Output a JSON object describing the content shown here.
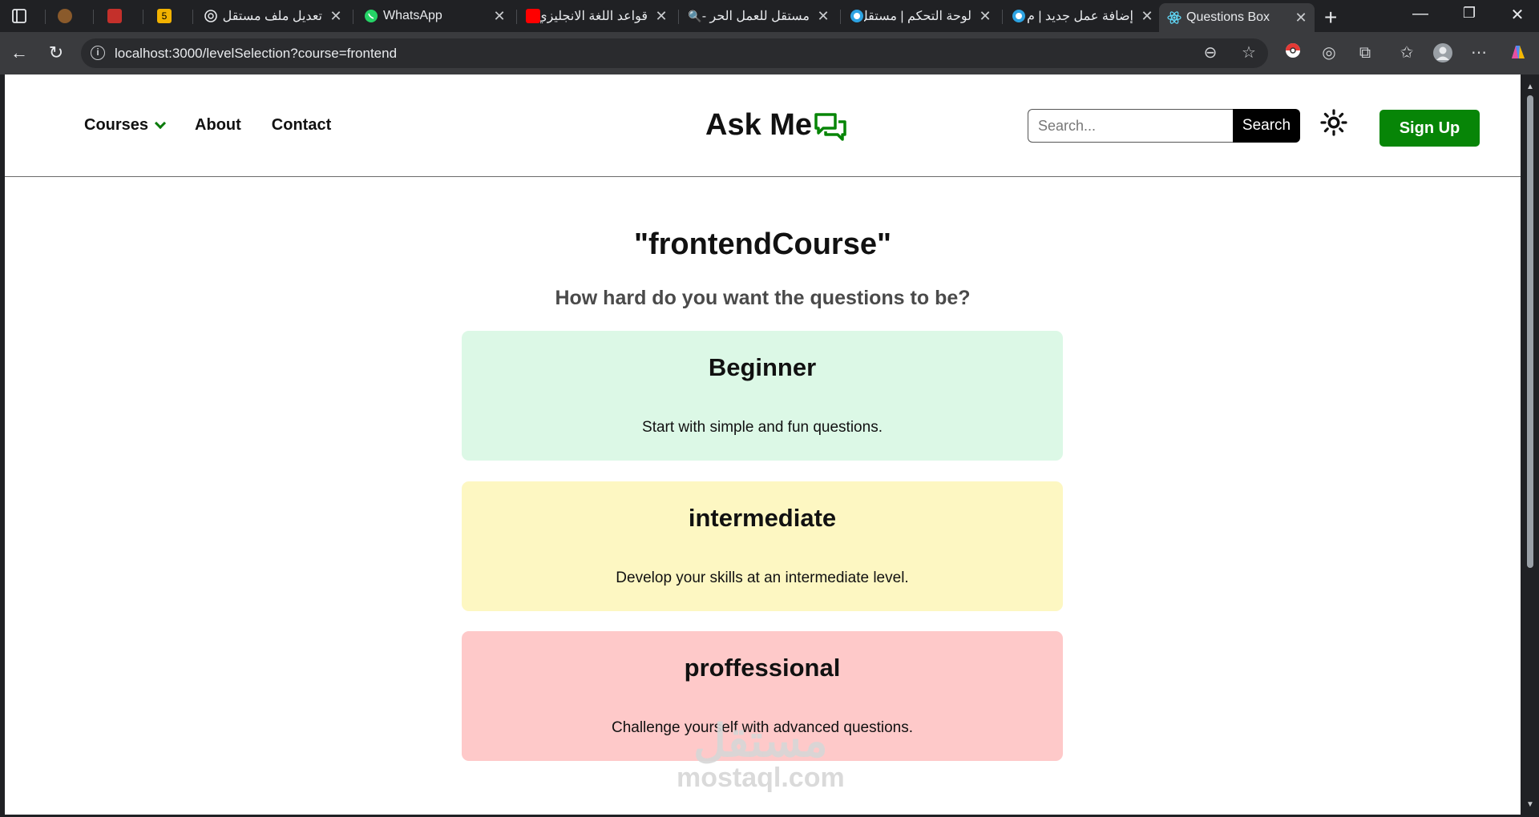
{
  "browser": {
    "tabs": [
      {
        "title": "",
        "favicon": "cocoa-icon",
        "color": "#8a5a2b"
      },
      {
        "title": "",
        "favicon": "youtube-icon",
        "color": "#c4302b"
      },
      {
        "title": "",
        "favicon": "number-5-icon",
        "color": "#f2b200",
        "badge": "5"
      },
      {
        "title": "تعديل ملف مستقل",
        "favicon": "openai-icon",
        "color": "#ffffff"
      },
      {
        "title": "WhatsApp",
        "favicon": "whatsapp-icon",
        "color": "#25d366"
      },
      {
        "title": "قواعد اللغة الانجليزي",
        "favicon": "youtube-icon",
        "color": "#ff0000"
      },
      {
        "title": "مستقل للعمل الحر -",
        "favicon": "search-icon",
        "color": "#1a73e8"
      },
      {
        "title": "لوحة التحكم | مستقل",
        "favicon": "mostaql-icon",
        "color": "#2da3e2"
      },
      {
        "title": "إضافة عمل جديد | م",
        "favicon": "mostaql-icon",
        "color": "#2da3e2"
      },
      {
        "title": "Questions Box",
        "favicon": "react-icon",
        "color": "#61dafb",
        "active": true
      }
    ],
    "url": "localhost:3000/levelSelection?course=frontend"
  },
  "site": {
    "nav": {
      "courses_label": "Courses",
      "about_label": "About",
      "contact_label": "Contact"
    },
    "logo_text": "Ask Me",
    "logo_icon": "chat-bubbles-icon",
    "accent_color": "#078507",
    "search": {
      "placeholder": "Search...",
      "button_label": "Search"
    },
    "theme_icon": "sun-icon",
    "signup_label": "Sign Up"
  },
  "main": {
    "course_title": "\"frontendCourse\"",
    "question": "How hard do you want the questions to be?",
    "levels": [
      {
        "name": "Beginner",
        "description": "Start with simple and fun questions.",
        "color": "#dcf8e6"
      },
      {
        "name": "intermediate",
        "description": "Develop your skills at an intermediate level.",
        "color": "#fdf7c2"
      },
      {
        "name": "proffessional",
        "description": "Challenge yourself with advanced questions.",
        "color": "#fec9c9"
      }
    ]
  },
  "watermark": {
    "arabic": "مستقل",
    "latin": "mostaql.com"
  }
}
